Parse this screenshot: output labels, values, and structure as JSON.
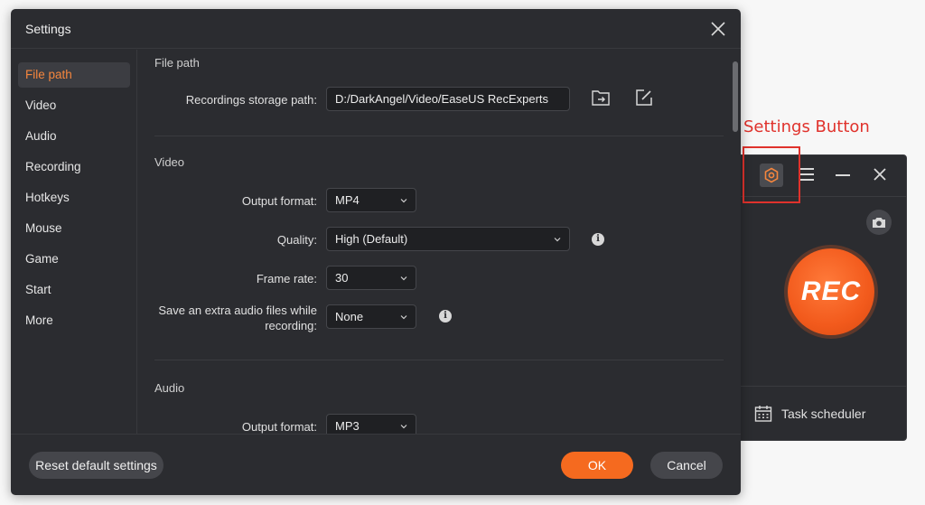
{
  "annotation": {
    "label": "Settings Button"
  },
  "recorder": {
    "rec_label": "REC",
    "task_scheduler_label": "Task scheduler",
    "icons": {
      "settings": "gear-icon",
      "menu": "menu-icon",
      "minimize": "minimize-icon",
      "close": "close-icon",
      "camera": "camera-icon",
      "calendar": "calendar-icon"
    }
  },
  "dialog": {
    "title": "Settings",
    "sidebar": {
      "items": [
        {
          "label": "File path",
          "active": true
        },
        {
          "label": "Video"
        },
        {
          "label": "Audio"
        },
        {
          "label": "Recording"
        },
        {
          "label": "Hotkeys"
        },
        {
          "label": "Mouse"
        },
        {
          "label": "Game"
        },
        {
          "label": "Start"
        },
        {
          "label": "More"
        }
      ]
    },
    "file_path": {
      "section_title": "File path",
      "storage_label": "Recordings storage path:",
      "storage_value": "D:/DarkAngel/Video/EaseUS RecExperts"
    },
    "video": {
      "section_title": "Video",
      "output_format_label": "Output format:",
      "output_format_value": "MP4",
      "quality_label": "Quality:",
      "quality_value": "High (Default)",
      "frame_rate_label": "Frame rate:",
      "frame_rate_value": "30",
      "extra_audio_label_line1": "Save an extra audio files while",
      "extra_audio_label_line2": "recording:",
      "extra_audio_value": "None"
    },
    "audio": {
      "section_title": "Audio",
      "output_format_label": "Output format:",
      "output_format_value": "MP3"
    },
    "footer": {
      "reset_label": "Reset default settings",
      "ok_label": "OK",
      "cancel_label": "Cancel"
    },
    "colors": {
      "accent": "#f56a1f",
      "background": "#2b2c30",
      "annotation": "#e0322c"
    }
  }
}
